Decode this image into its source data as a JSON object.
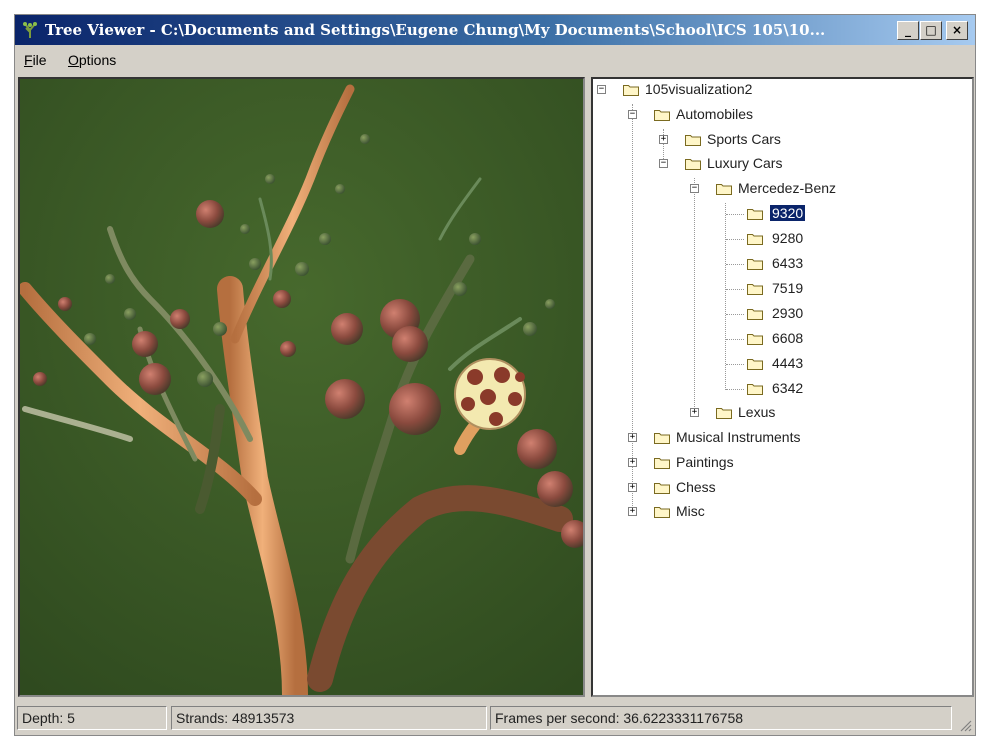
{
  "window": {
    "title": "Tree Viewer - C:\\Documents and Settings\\Eugene Chung\\My Documents\\School\\ICS 105\\10...",
    "minimize": "_",
    "maximize": "□",
    "close": "×"
  },
  "menu": {
    "file": {
      "hotkey": "F",
      "rest": "ile"
    },
    "options": {
      "hotkey": "O",
      "rest": "ptions"
    }
  },
  "tree": {
    "root": "105visualization2",
    "automobiles": "Automobiles",
    "sports_cars": "Sports Cars",
    "luxury_cars": "Luxury Cars",
    "mercedes": "Mercedez-Benz",
    "models": [
      "9320",
      "9280",
      "6433",
      "7519",
      "2930",
      "6608",
      "4443",
      "6342"
    ],
    "selected_model": "9320",
    "lexus": "Lexus",
    "musical": "Musical Instruments",
    "paintings": "Paintings",
    "chess": "Chess",
    "misc": "Misc",
    "expand_symbol": "+",
    "collapse_symbol": "−"
  },
  "status": {
    "depth": "Depth: 5",
    "strands": "Strands: 48913573",
    "fps": "Frames per second: 36.6223331176758"
  },
  "colors": {
    "viewport_bg": "#3e5f28",
    "branch": "#d9965e",
    "fruit": "#a85a4a",
    "selected_fruit": "#f3e9b0",
    "selection": "#0a246a"
  }
}
